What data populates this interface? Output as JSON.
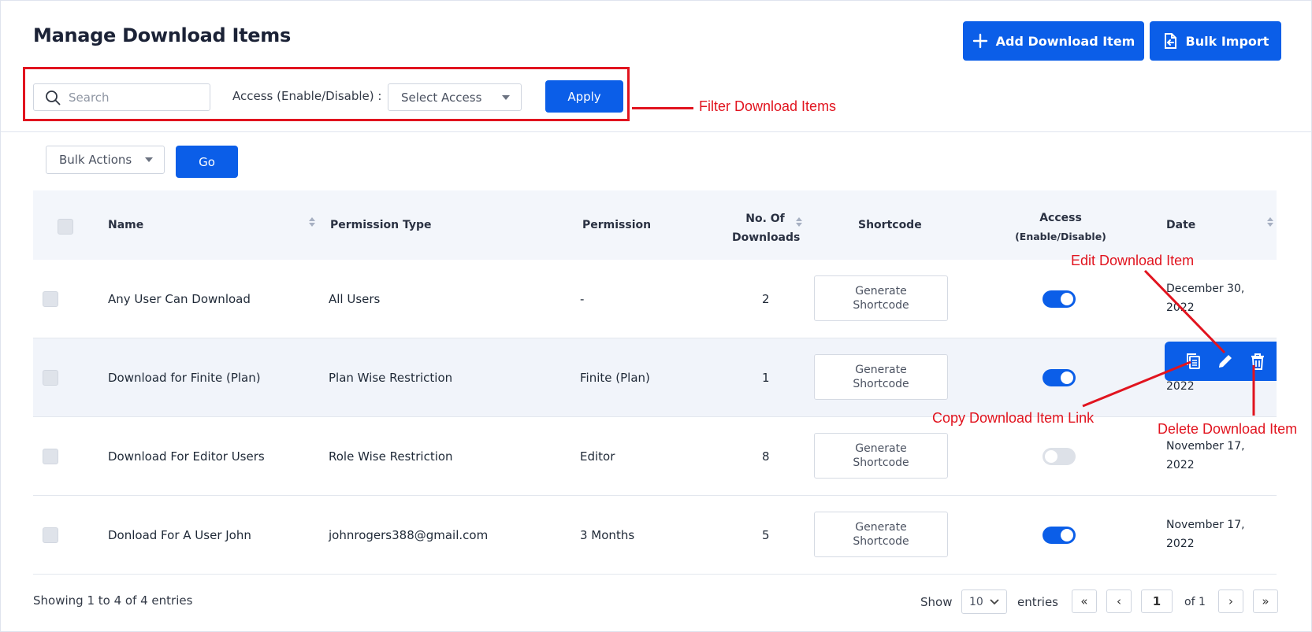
{
  "page": {
    "title": "Manage Download Items",
    "add_button": "Add Download Item",
    "bulk_import_button": "Bulk Import"
  },
  "filter": {
    "search_placeholder": "Search",
    "access_label": "Access (Enable/Disable) :",
    "access_select": "Select Access",
    "apply_button": "Apply"
  },
  "bulk": {
    "select": "Bulk Actions",
    "go_button": "Go"
  },
  "table": {
    "headers": {
      "name": "Name",
      "permission_type": "Permission Type",
      "permission": "Permission",
      "downloads_line1": "No. Of",
      "downloads_line2": "Downloads",
      "shortcode": "Shortcode",
      "access_line1": "Access",
      "access_line2": "(Enable/Disable)",
      "date": "Date"
    },
    "rows": [
      {
        "name": "Any User Can Download",
        "permission_type": "All Users",
        "permission": "-",
        "downloads": "2",
        "shortcode_line1": "Generate",
        "shortcode_line2": "Shortcode",
        "access_enabled": true,
        "date_line1": "December 30,",
        "date_line2": "2022"
      },
      {
        "name": "Download for Finite (Plan)",
        "permission_type": "Plan Wise Restriction",
        "permission": "Finite (Plan)",
        "downloads": "1",
        "shortcode_line1": "Generate",
        "shortcode_line2": "Shortcode",
        "access_enabled": true,
        "date_line1": "",
        "date_line2": "2022"
      },
      {
        "name": "Download For Editor Users",
        "permission_type": "Role Wise Restriction",
        "permission": "Editor",
        "downloads": "8",
        "shortcode_line1": "Generate",
        "shortcode_line2": "Shortcode",
        "access_enabled": false,
        "date_line1": "November 17,",
        "date_line2": "2022"
      },
      {
        "name": "Donload For A User John",
        "permission_type": "johnrogers388@gmail.com",
        "permission": "3 Months",
        "downloads": "5",
        "shortcode_line1": "Generate",
        "shortcode_line2": "Shortcode",
        "access_enabled": true,
        "date_line1": "November 17,",
        "date_line2": "2022"
      }
    ]
  },
  "row_actions": [
    "copy-icon",
    "edit-icon",
    "delete-icon"
  ],
  "footer": {
    "showing": "Showing 1 to 4 of 4 entries",
    "show_label": "Show",
    "page_size": "10",
    "entries_label": "entries",
    "first": "«",
    "prev": "‹",
    "current_page": "1",
    "of_pages": "of 1",
    "next": "›",
    "last": "»"
  },
  "annotations": {
    "filter": "Filter Download Items",
    "edit": "Edit Download Item",
    "copy": "Copy Download Item Link",
    "delete": "Delete Download Item"
  },
  "colors": {
    "primary": "#0b5ee8",
    "annotation": "#e1141f"
  }
}
